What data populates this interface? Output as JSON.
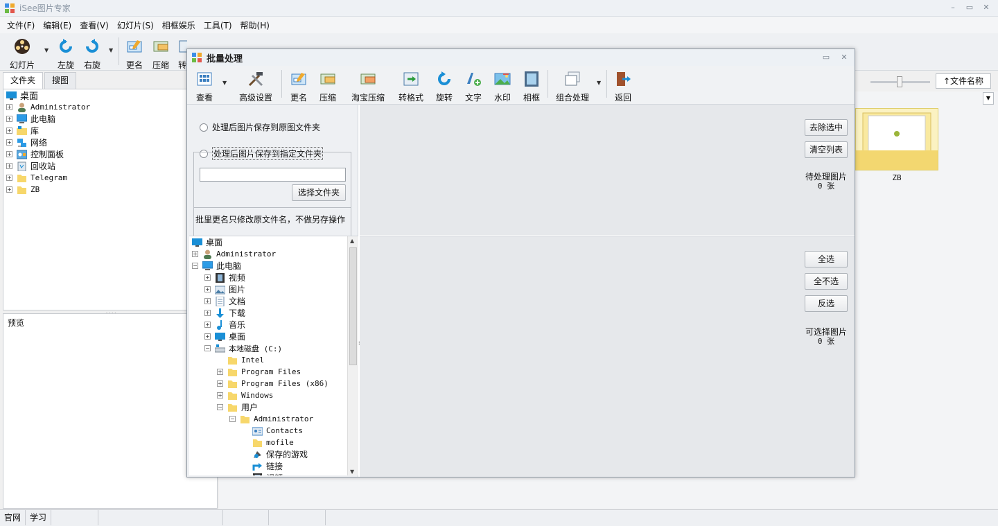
{
  "app": {
    "title": "iSee图片专家",
    "window_buttons": [
      "–",
      "▭",
      "✕"
    ]
  },
  "menu": [
    "文件(F)",
    "编辑(E)",
    "查看(V)",
    "幻灯片(S)",
    "相框娱乐",
    "工具(T)",
    "帮助(H)"
  ],
  "toolbar": {
    "slideshow": "幻灯片",
    "rotate_left": "左旋",
    "rotate_right": "右旋",
    "rename": "更名",
    "compress": "压缩",
    "convert_partial": "转"
  },
  "left_panel": {
    "tabs": [
      "文件夹",
      "搜图"
    ],
    "tree": [
      "桌面",
      "Administrator",
      "此电脑",
      "库",
      "网络",
      "控制面板",
      "回收站",
      "Telegram",
      "ZB"
    ],
    "preview_label": "预览"
  },
  "right_area": {
    "sort_label": "↑文件名称",
    "thumb_label": "ZB"
  },
  "statusbar": [
    "官网",
    "学习",
    "",
    "",
    "",
    ""
  ],
  "dialog": {
    "title": "批量处理",
    "toolbar": [
      "查看",
      "高级设置",
      "更名",
      "压缩",
      "淘宝压缩",
      "转格式",
      "旋转",
      "文字",
      "水印",
      "相框",
      "组合处理",
      "返回"
    ],
    "radio_original": "处理后图片保存到原图文件夹",
    "radio_specified": "处理后图片保存到指定文件夹",
    "path_value": "",
    "choose_folder": "选择文件夹",
    "note": "批里更名只修改原文件名，不做另存操作",
    "tree": [
      {
        "label": "桌面",
        "level": 0,
        "pm": "",
        "icon": "desktop"
      },
      {
        "label": "Administrator",
        "level": 0,
        "pm": "+",
        "icon": "user",
        "mono": true
      },
      {
        "label": "此电脑",
        "level": 0,
        "pm": "−",
        "icon": "pc"
      },
      {
        "label": "视频",
        "level": 1,
        "pm": "+",
        "icon": "video"
      },
      {
        "label": "图片",
        "level": 1,
        "pm": "+",
        "icon": "picture"
      },
      {
        "label": "文档",
        "level": 1,
        "pm": "+",
        "icon": "doc"
      },
      {
        "label": "下载",
        "level": 1,
        "pm": "+",
        "icon": "download"
      },
      {
        "label": "音乐",
        "level": 1,
        "pm": "+",
        "icon": "music"
      },
      {
        "label": "桌面",
        "level": 1,
        "pm": "+",
        "icon": "desktop"
      },
      {
        "label": "本地磁盘 (C:)",
        "level": 1,
        "pm": "−",
        "icon": "disk",
        "mono": true
      },
      {
        "label": "Intel",
        "level": 2,
        "pm": "",
        "icon": "folder",
        "mono": true
      },
      {
        "label": "Program Files",
        "level": 2,
        "pm": "+",
        "icon": "folder",
        "mono": true
      },
      {
        "label": "Program Files (x86)",
        "level": 2,
        "pm": "+",
        "icon": "folder",
        "mono": true
      },
      {
        "label": "Windows",
        "level": 2,
        "pm": "+",
        "icon": "folder",
        "mono": true
      },
      {
        "label": "用户",
        "level": 2,
        "pm": "−",
        "icon": "folder"
      },
      {
        "label": "Administrator",
        "level": 3,
        "pm": "−",
        "icon": "folder",
        "mono": true
      },
      {
        "label": "Contacts",
        "level": 4,
        "pm": "",
        "icon": "contacts",
        "mono": true
      },
      {
        "label": "mofile",
        "level": 4,
        "pm": "",
        "icon": "folder",
        "mono": true
      },
      {
        "label": "保存的游戏",
        "level": 4,
        "pm": "",
        "icon": "game"
      },
      {
        "label": "链接",
        "level": 4,
        "pm": "",
        "icon": "link"
      },
      {
        "label": "视频",
        "level": 4,
        "pm": "",
        "icon": "video"
      }
    ],
    "buttons_top": [
      "去除选中",
      "清空列表"
    ],
    "pending_label": "待处理图片",
    "pending_count": "0 张",
    "buttons_bottom": [
      "全选",
      "全不选",
      "反选"
    ],
    "selectable_label": "可选择图片",
    "selectable_count": "0 张"
  },
  "colors": {
    "accent_blue": "#1a8fd6",
    "folder_yellow": "#f7d76b",
    "dialog_bg": "#e6e8eb"
  }
}
